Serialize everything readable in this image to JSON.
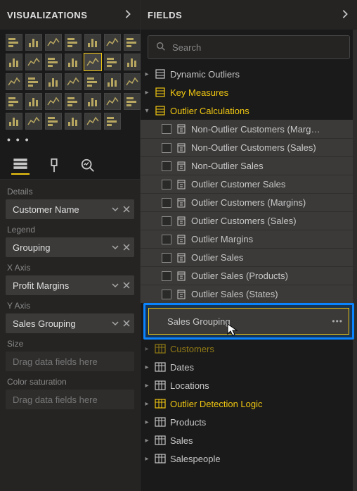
{
  "viz_pane": {
    "title": "VISUALIZATIONS",
    "more": "• • •",
    "icons": [
      "stacked-bar",
      "clustered-bar",
      "stacked-column",
      "clustered-column",
      "line",
      "area",
      "stacked-area",
      "line-bar",
      "ribbon",
      "waterfall",
      "funnel",
      "scatter",
      "pie",
      "donut",
      "treemap",
      "map",
      "filled-map",
      "gauge",
      "card",
      "multi-card",
      "kpi",
      "slicer",
      "table",
      "matrix",
      "r-visual",
      "py-visual",
      "arc-gis",
      "key-influencers",
      "decomp",
      "qa",
      "paginated",
      "narrative",
      "R",
      "globe"
    ],
    "selectedIndex": 11,
    "tools": [
      "fields-tool",
      "format-tool",
      "analytics-tool"
    ],
    "wells": [
      {
        "label": "Details",
        "value": "Customer Name",
        "filled": true
      },
      {
        "label": "Legend",
        "value": "Grouping",
        "filled": true
      },
      {
        "label": "X Axis",
        "value": "Profit Margins",
        "filled": true
      },
      {
        "label": "Y Axis",
        "value": "Sales Grouping",
        "filled": true
      },
      {
        "label": "Size",
        "value": "Drag data fields here",
        "filled": false
      },
      {
        "label": "Color saturation",
        "value": "Drag data fields here",
        "filled": false
      }
    ]
  },
  "fields_pane": {
    "title": "FIELDS",
    "search_placeholder": "Search",
    "tables": [
      {
        "name": "Dynamic Outliers",
        "expanded": false,
        "highlight": false,
        "icon": "measure"
      },
      {
        "name": "Key Measures",
        "expanded": false,
        "highlight": true,
        "icon": "measure"
      },
      {
        "name": "Outlier Calculations",
        "expanded": true,
        "highlight": true,
        "icon": "measure",
        "children": [
          {
            "name": "Non-Outlier Customers (Marg…",
            "checked": false
          },
          {
            "name": "Non-Outlier Customers (Sales)",
            "checked": false
          },
          {
            "name": "Non-Outlier Sales",
            "checked": false
          },
          {
            "name": "Outlier Customer Sales",
            "checked": false
          },
          {
            "name": "Outlier Customers (Margins)",
            "checked": false
          },
          {
            "name": "Outlier Customers (Sales)",
            "checked": false
          },
          {
            "name": "Outlier Margins",
            "checked": false
          },
          {
            "name": "Outlier Sales",
            "checked": false
          },
          {
            "name": "Outlier Sales (Products)",
            "checked": false
          },
          {
            "name": "Outlier Sales (States)",
            "checked": false
          }
        ]
      },
      {
        "name": "Customers",
        "expanded": false,
        "highlight": true,
        "icon": "table",
        "cut": true
      },
      {
        "name": "Dates",
        "expanded": false,
        "highlight": false,
        "icon": "table"
      },
      {
        "name": "Locations",
        "expanded": false,
        "highlight": false,
        "icon": "table"
      },
      {
        "name": "Outlier Detection Logic",
        "expanded": false,
        "highlight": true,
        "icon": "table"
      },
      {
        "name": "Products",
        "expanded": false,
        "highlight": false,
        "icon": "table"
      },
      {
        "name": "Sales",
        "expanded": false,
        "highlight": false,
        "icon": "table"
      },
      {
        "name": "Salespeople",
        "expanded": false,
        "highlight": false,
        "icon": "table"
      }
    ],
    "drag_item": {
      "name": "Sales Grouping",
      "checked": true
    }
  }
}
